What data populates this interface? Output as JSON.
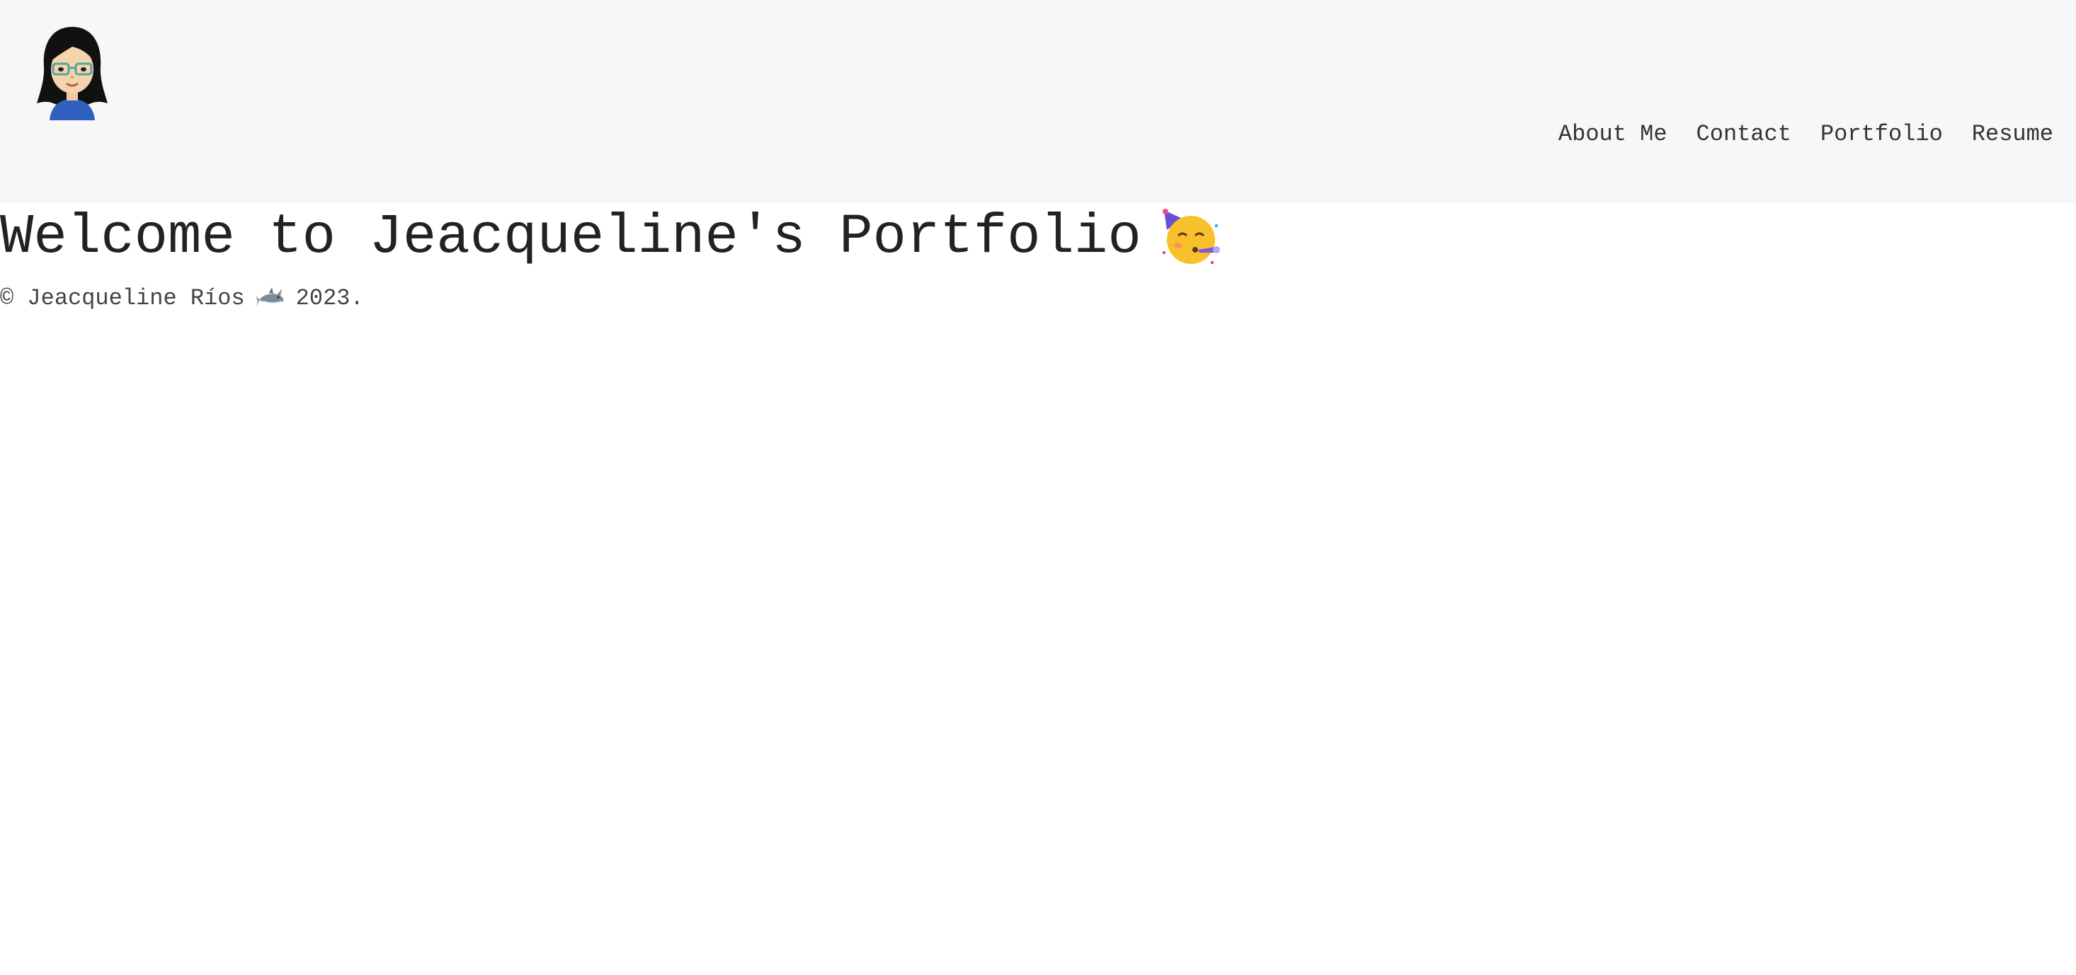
{
  "header": {
    "avatar_alt": "avatar",
    "nav": [
      {
        "label": "About Me"
      },
      {
        "label": "Contact"
      },
      {
        "label": "Portfolio"
      },
      {
        "label": "Resume"
      }
    ]
  },
  "main": {
    "title": "Welcome to Jeacqueline's Portfolio",
    "title_icon": "partying-face-icon"
  },
  "footer": {
    "prefix": "© Jeacqueline Ríos",
    "icon": "shark-icon",
    "suffix": "2023."
  },
  "colors": {
    "header_bg": "#f7f7f7",
    "text": "#333333",
    "avatar_shirt": "#2f5fbf"
  }
}
